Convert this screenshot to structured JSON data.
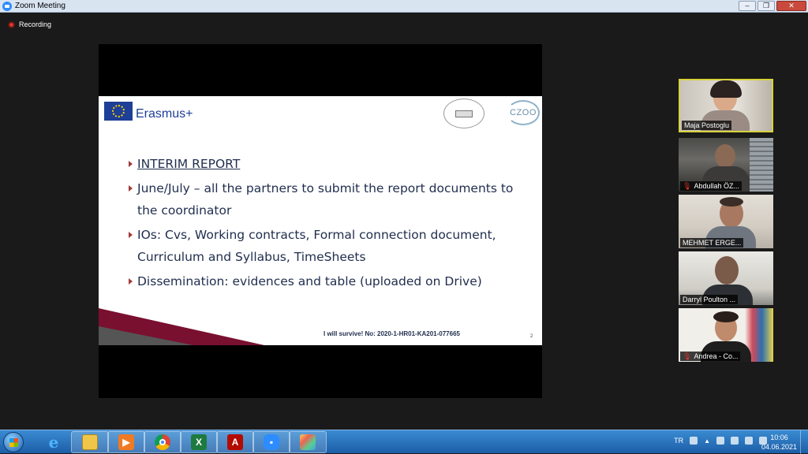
{
  "window": {
    "title": "Zoom Meeting",
    "minimize_label": "‒",
    "maximize_label": "❐",
    "close_label": "✕"
  },
  "meeting": {
    "recording_label": "Recording"
  },
  "slide": {
    "brand": "Erasmus+",
    "logo_right": "CZOO",
    "logo_center": "I WILL SURVIVE",
    "bullets": [
      "INTERIM REPORT",
      "June/July – all the partners to submit the report documents to the coordinator",
      "IOs: Cvs, Working contracts, Formal connection document, Curriculum and Syllabus, TimeSheets",
      "Dissemination: evidences and table (uploaded on Drive)"
    ],
    "footer": "I will survive! No: 2020-1-HR01-KA201-077665",
    "page_number": "2"
  },
  "participants": [
    {
      "name": "Maja Postoglu",
      "muted": false,
      "active": true
    },
    {
      "name": "Abdullah ÖZ...",
      "muted": true,
      "active": false
    },
    {
      "name": "MEHMET ERGE...",
      "muted": false,
      "active": false
    },
    {
      "name": "Darryl Poulton ...",
      "muted": false,
      "active": false
    },
    {
      "name": "Andrea - Co...",
      "muted": true,
      "active": false
    }
  ],
  "taskbar": {
    "apps": [
      "internet-explorer",
      "file-explorer",
      "media-player",
      "chrome",
      "excel",
      "acrobat",
      "zoom",
      "paint"
    ],
    "language": "TR",
    "time": "10:06",
    "date": "04.06.2021"
  }
}
